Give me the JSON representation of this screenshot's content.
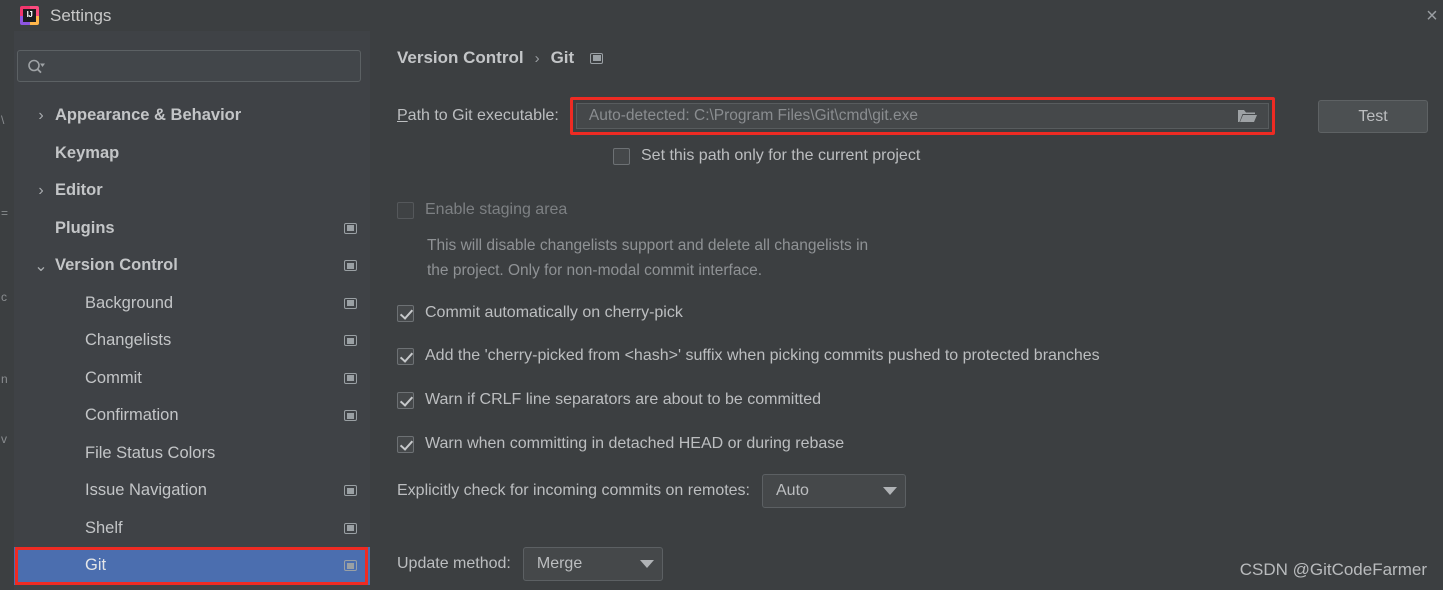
{
  "window": {
    "title": "Settings",
    "logo_text": "IJ",
    "close_icon": "×"
  },
  "sidebar": {
    "search": {
      "value": "",
      "placeholder": ""
    },
    "items": [
      {
        "label": "Appearance & Behavior",
        "level": "top",
        "arrow": "›",
        "scope_icon": false,
        "selected": false
      },
      {
        "label": "Keymap",
        "level": "top",
        "arrow": "",
        "scope_icon": false,
        "selected": false
      },
      {
        "label": "Editor",
        "level": "top",
        "arrow": "›",
        "scope_icon": false,
        "selected": false
      },
      {
        "label": "Plugins",
        "level": "top",
        "arrow": "",
        "scope_icon": true,
        "selected": false
      },
      {
        "label": "Version Control",
        "level": "top",
        "arrow": "⌄",
        "scope_icon": true,
        "selected": false
      },
      {
        "label": "Background",
        "level": "child",
        "arrow": "",
        "scope_icon": true,
        "selected": false
      },
      {
        "label": "Changelists",
        "level": "child",
        "arrow": "",
        "scope_icon": true,
        "selected": false
      },
      {
        "label": "Commit",
        "level": "child",
        "arrow": "",
        "scope_icon": true,
        "selected": false
      },
      {
        "label": "Confirmation",
        "level": "child",
        "arrow": "",
        "scope_icon": true,
        "selected": false
      },
      {
        "label": "File Status Colors",
        "level": "child",
        "arrow": "",
        "scope_icon": false,
        "selected": false
      },
      {
        "label": "Issue Navigation",
        "level": "child",
        "arrow": "",
        "scope_icon": true,
        "selected": false
      },
      {
        "label": "Shelf",
        "level": "child",
        "arrow": "",
        "scope_icon": true,
        "selected": false
      },
      {
        "label": "Git",
        "level": "child",
        "arrow": "",
        "scope_icon": true,
        "selected": true
      }
    ]
  },
  "main": {
    "breadcrumb": {
      "parent": "Version Control",
      "separator": "›",
      "current": "Git"
    },
    "path_row": {
      "label_mnemonic": "P",
      "label_rest": "ath to Git executable:",
      "value": "",
      "placeholder": "Auto-detected: C:\\Program Files\\Git\\cmd\\git.exe",
      "test_button": "Test"
    },
    "checkboxes": [
      {
        "label": "Set this path only for the current project",
        "checked": false,
        "disabled": false
      },
      {
        "label": "Enable staging area",
        "checked": false,
        "disabled": true
      },
      {
        "label": "Commit automatically on cherry-pick",
        "checked": true,
        "disabled": false
      },
      {
        "label": "Add the 'cherry-picked from <hash>' suffix when picking commits pushed to protected branches",
        "checked": true,
        "disabled": false
      },
      {
        "label": "Warn if CRLF line separators are about to be committed",
        "checked": true,
        "disabled": false
      },
      {
        "label": "Warn when committing in detached HEAD or during rebase",
        "checked": true,
        "disabled": false
      }
    ],
    "staging_help_line1": "This will disable changelists support and delete all changelists in",
    "staging_help_line2": "the project. Only for non-modal commit interface.",
    "incoming_commits": {
      "label": "Explicitly check for incoming commits on remotes:",
      "value": "Auto"
    },
    "update_method": {
      "label": "Update method:",
      "value": "Merge"
    }
  },
  "watermark": "CSDN @GitCodeFarmer",
  "colors": {
    "selection": "#4b6eaf",
    "annotation": "#ee2b23",
    "panel_bg": "#3c3f41",
    "sidebar_bg": "#3f4246"
  }
}
